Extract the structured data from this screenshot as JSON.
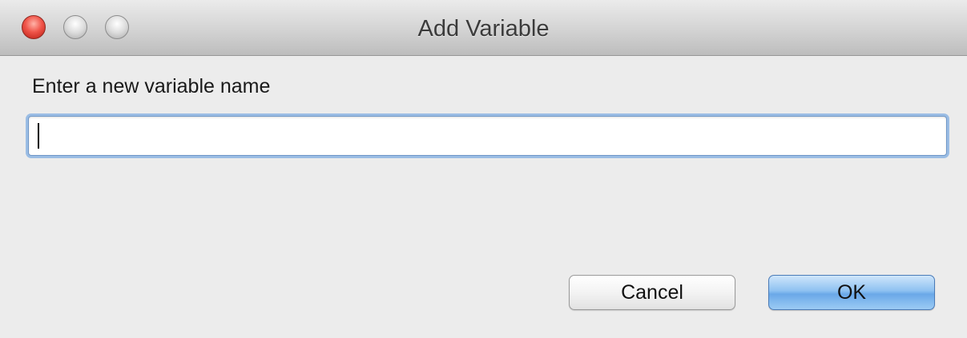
{
  "window": {
    "title": "Add Variable"
  },
  "dialog": {
    "prompt": "Enter a new variable name",
    "input_value": ""
  },
  "buttons": {
    "cancel_label": "Cancel",
    "ok_label": "OK"
  },
  "icons": {
    "close": "close-icon",
    "minimize": "minimize-icon",
    "zoom": "zoom-icon"
  },
  "colors": {
    "close_button": "#f0554a",
    "default_button": "#8ec1f1",
    "focus_ring": "#9bbde4"
  }
}
